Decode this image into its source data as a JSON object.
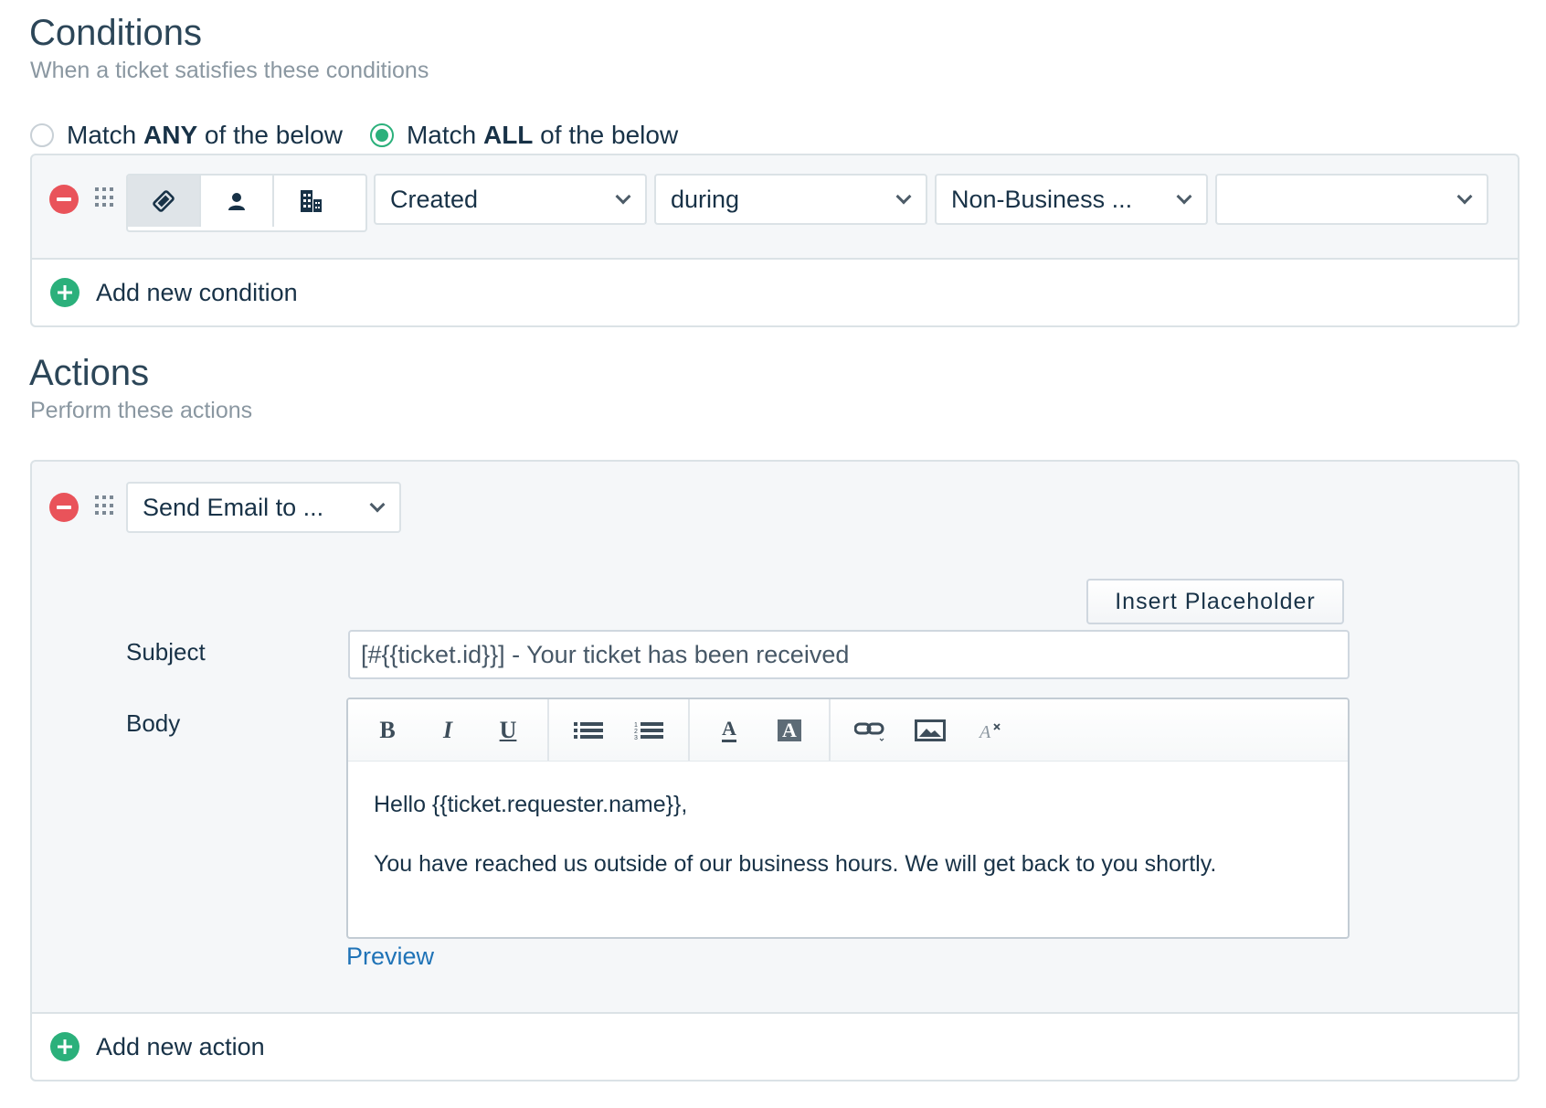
{
  "conditions": {
    "title": "Conditions",
    "subtitle": "When a ticket satisfies these conditions",
    "match_any": {
      "prefix": "Match ",
      "keyword": "ANY",
      "suffix": " of the below",
      "checked": false
    },
    "match_all": {
      "prefix": "Match ",
      "keyword": "ALL",
      "suffix": " of the below",
      "checked": true
    },
    "row": {
      "entity_tabs": [
        "ticket-icon",
        "user-icon",
        "building-icon"
      ],
      "active_tab": "ticket-icon",
      "field": "Created",
      "operator": "during",
      "value": "Non-Business ...",
      "extra": ""
    },
    "add_label": "Add new condition"
  },
  "actions": {
    "title": "Actions",
    "subtitle": "Perform these actions",
    "action_type": "Send Email to ...",
    "insert_placeholder": "Insert Placeholder",
    "subject_label": "Subject",
    "subject_value": "[#{{ticket.id}}] - Your ticket has been received",
    "body_label": "Body",
    "body_lines": [
      "Hello {{ticket.requester.name}},",
      "You have reached us outside of our business hours. We will get back to you shortly."
    ],
    "toolbar": {
      "bold": "B",
      "italic": "I",
      "underline": "U",
      "font_color": "A",
      "bg_color": "A"
    },
    "preview": "Preview",
    "add_label": "Add new action"
  },
  "colors": {
    "accent_green": "#2bb07b",
    "remove_red": "#e9535a",
    "link_blue": "#1f73b7"
  }
}
